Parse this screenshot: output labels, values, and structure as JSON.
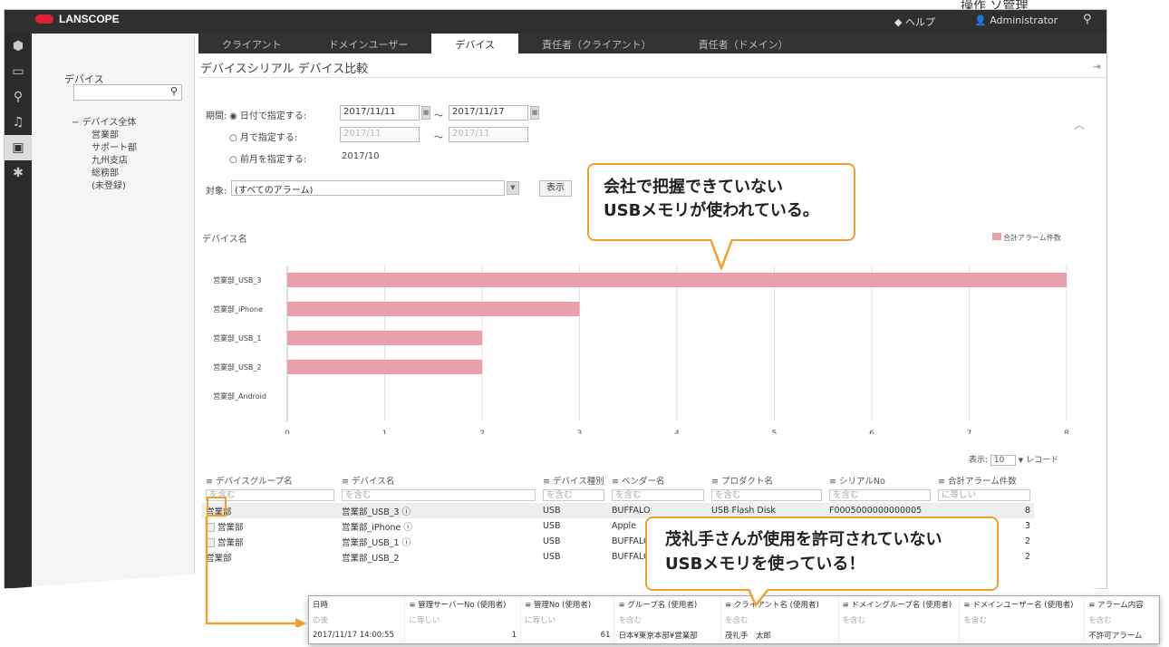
{
  "page_corner_label": "操作 ソ管理",
  "app": {
    "logo": "LANSCOPE",
    "help": "◆ ヘルプ",
    "user": "Administrator"
  },
  "tabs": [
    "クライアント",
    "ドメインユーザー",
    "デバイス",
    "責任者（クライアント）",
    "責任者（ドメイン）"
  ],
  "active_tab": 2,
  "rail_icons": [
    "shield-icon",
    "monitor-icon",
    "search-icon",
    "bell-icon",
    "report-icon",
    "gear-icon"
  ],
  "sidebar": {
    "title": "デバイス",
    "tree": [
      {
        "label": "デバイス全体",
        "children": [
          "営業部",
          "サポート部",
          "九州支店",
          "総務部",
          "(未登録)"
        ]
      }
    ]
  },
  "page_title": "デバイスシリアル デバイス比較",
  "period": {
    "label": "期間:",
    "opt_date": "日付で指定する:",
    "date_from": "2017/11/11",
    "date_to": "2017/11/17",
    "opt_month": "月で指定する:",
    "month_from": "2017/11",
    "month_to": "2017/11",
    "opt_fiscal": "前月を指定する:",
    "fiscal_value": "2017/10",
    "tilde": "〜"
  },
  "target": {
    "label": "対象:",
    "value": "(すべてのアラーム)",
    "show_button": "表示"
  },
  "callout1": [
    "会社で把握できていない",
    "USBメモリが使われている。"
  ],
  "chart_data": {
    "type": "bar",
    "orientation": "horizontal",
    "ylabel": "デバイス名",
    "legend": "合計アラーム件数",
    "legend_position": "top-right",
    "categories": [
      "営業部_USB_3",
      "営業部_iPhone",
      "営業部_USB_1",
      "営業部_USB_2",
      "営業部_Android"
    ],
    "values": [
      8,
      3,
      2,
      2,
      0
    ],
    "xlim": [
      0,
      8
    ],
    "ticks": [
      0,
      1,
      2,
      3,
      4,
      5,
      6,
      7,
      8
    ],
    "bar_color": "#e8a0aa"
  },
  "pager": {
    "prefix": "表示:",
    "value": "10",
    "suffix": "レコード"
  },
  "table": {
    "columns": [
      "デバイスグループ名",
      "デバイス名",
      "デバイス種別",
      "ベンダー名",
      "プロダクト名",
      "シリアルNo",
      "合計アラーム件数"
    ],
    "filters": [
      "を含む",
      "を含む",
      "を含む",
      "を含む",
      "を含む",
      "を含む",
      "に等しい"
    ],
    "rows": [
      [
        "営業部",
        "営業部_USB_3",
        "USB",
        "BUFFALO",
        "USB Flash Disk",
        "F0005000000000005",
        "8"
      ],
      [
        "営業部",
        "営業部_iPhone",
        "USB",
        "Apple",
        "",
        "",
        "3"
      ],
      [
        "営業部",
        "営業部_USB_1",
        "USB",
        "BUFFALO",
        "",
        "",
        "2"
      ],
      [
        "営業部",
        "営業部_USB_2",
        "USB",
        "BUFFALO",
        "",
        "",
        "2"
      ]
    ]
  },
  "callout2": [
    "茂礼手さんが使用を許可されていない",
    "USBメモリを使っている！"
  ],
  "subtable": {
    "columns": [
      "日時",
      "管理サーバーNo (使用者)",
      "管理No (使用者)",
      "グループ名 (使用者)",
      "クライアント名 (使用者)",
      "ドメイングループ名 (使用者)",
      "ドメインユーザー名 (使用者)",
      "アラーム内容"
    ],
    "filters": [
      "の後",
      "に等しい",
      "に等しい",
      "を含む",
      "を含む",
      "を含む",
      "を含む",
      "を含む"
    ],
    "row": [
      "2017/11/17 14:00:55",
      "1",
      "61",
      "日本¥東京本部¥営業部",
      "茂礼手　太郎",
      "",
      "",
      "不許可アラーム"
    ]
  }
}
